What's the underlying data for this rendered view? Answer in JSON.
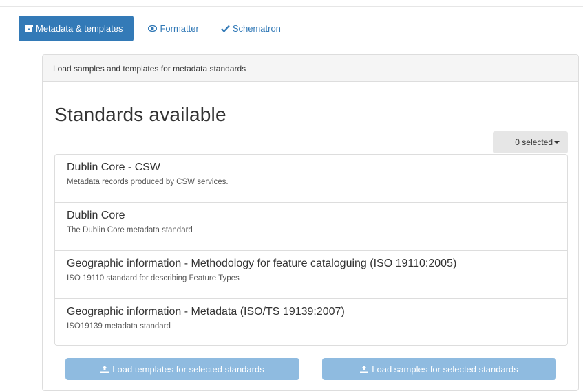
{
  "tabs": [
    {
      "label": "Metadata & templates",
      "icon": "archive-icon",
      "active": true
    },
    {
      "label": "Formatter",
      "icon": "eye-icon",
      "active": false
    },
    {
      "label": "Schematron",
      "icon": "check-icon",
      "active": false
    }
  ],
  "panel": {
    "heading": "Load samples and templates for metadata standards",
    "title": "Standards available",
    "selected_label": "0 selected"
  },
  "standards": [
    {
      "name": "Dublin Core - CSW",
      "description": "Metadata records produced by CSW services."
    },
    {
      "name": "Dublin Core",
      "description": "The Dublin Core metadata standard"
    },
    {
      "name": "Geographic information - Methodology for feature cataloguing (ISO 19110:2005)",
      "description": "ISO 19110 standard for describing Feature Types"
    },
    {
      "name": "Geographic information - Metadata (ISO/TS 19139:2007)",
      "description": "ISO19139 metadata standard"
    }
  ],
  "buttons": {
    "load_templates": "Load templates for selected standards",
    "load_samples": "Load samples for selected standards",
    "icon": "upload-icon"
  },
  "colors": {
    "accent": "#337ab7",
    "disabled_button": "#8fbbe0"
  }
}
